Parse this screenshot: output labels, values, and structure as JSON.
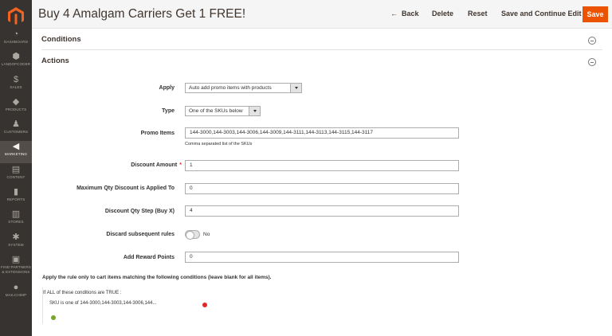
{
  "header": {
    "title": "Buy 4 Amalgam Carriers Get 1 FREE!",
    "back_label": "Back",
    "back_arrow": "←",
    "delete_label": "Delete",
    "reset_label": "Reset",
    "save_continue_label": "Save and Continue Edit",
    "save_label": "Save"
  },
  "sidebar": {
    "items": [
      {
        "label": "Dashboard",
        "icon": "dashboard-icon",
        "glyph": "◔"
      },
      {
        "label": "Landofcoder",
        "icon": "hexagon-icon",
        "glyph": "⬢"
      },
      {
        "label": "Sales",
        "icon": "dollar-icon",
        "glyph": "$"
      },
      {
        "label": "Products",
        "icon": "box-icon",
        "glyph": "◆"
      },
      {
        "label": "Customers",
        "icon": "person-icon",
        "glyph": "♟"
      },
      {
        "label": "Marketing",
        "icon": "megaphone-icon",
        "glyph": "◀"
      },
      {
        "label": "Content",
        "icon": "content-icon",
        "glyph": "▤"
      },
      {
        "label": "Reports",
        "icon": "bar-chart-icon",
        "glyph": "▮"
      },
      {
        "label": "Stores",
        "icon": "store-icon",
        "glyph": "▥"
      },
      {
        "label": "System",
        "icon": "gear-icon",
        "glyph": "✱"
      },
      {
        "label": "Find Partners & Extensions",
        "icon": "partners-icon",
        "glyph": "▣"
      },
      {
        "label": "Mailchimp",
        "icon": "mailchimp-icon",
        "glyph": "●"
      }
    ]
  },
  "sections": {
    "conditions": "Conditions",
    "actions": "Actions"
  },
  "form": {
    "apply": {
      "label": "Apply",
      "value": "Auto add promo items with products"
    },
    "type": {
      "label": "Type",
      "value": "One of the SKUs below"
    },
    "promo_items": {
      "label": "Promo Items",
      "value": "144-3000,144-3003,144-3006,144-3009,144-3111,144-3113,144-3115,144-3117",
      "note": "Comma separated list of the SKUs"
    },
    "discount_amount": {
      "label": "Discount Amount",
      "required": "*",
      "value": "1"
    },
    "max_qty": {
      "label": "Maximum Qty Discount is Applied To",
      "value": "0"
    },
    "qty_step": {
      "label": "Discount Qty Step (Buy X)",
      "value": "4"
    },
    "discard": {
      "label": "Discard subsequent rules",
      "value": "No"
    },
    "reward_points": {
      "label": "Add Reward Points",
      "value": "0"
    }
  },
  "conditions_block": {
    "intro": "Apply the rule only to cart items matching the following conditions (leave blank for all items).",
    "if_text": "If",
    "aggregator": "ALL",
    "tail_text": "of these conditions are",
    "value": "TRUE",
    "colon": ":",
    "sku_label": "SKU",
    "operator": "is one of",
    "sku_value": "144-3000,144-3003,144-3006,144...",
    "colors": {
      "remove": "#e22626",
      "add": "#79a22e"
    }
  },
  "colors": {
    "accent": "#eb5202",
    "sidebar": "#373330"
  }
}
